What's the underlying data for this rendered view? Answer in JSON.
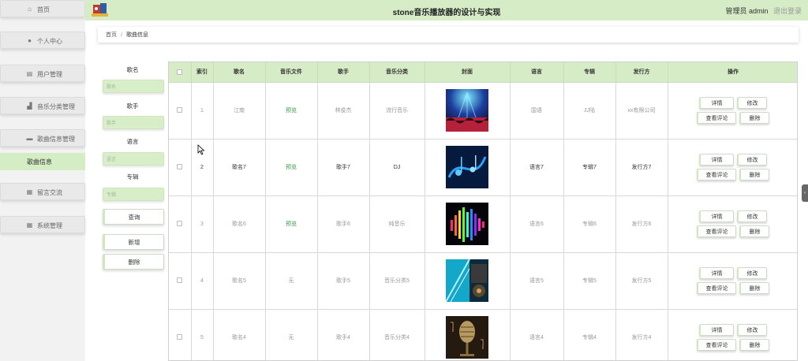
{
  "header": {
    "title": "stone音乐播放器的设计与实现",
    "admin_text": "管理员 admin",
    "logout": "退出登录"
  },
  "sidebar": {
    "items": [
      {
        "label": "首页",
        "icon": "home-icon"
      },
      {
        "label": "个人中心",
        "icon": "user-icon"
      },
      {
        "label": "用户管理",
        "icon": "clipboard-icon"
      },
      {
        "label": "音乐分类管理",
        "icon": "hammer-icon"
      },
      {
        "label": "歌曲信息管理",
        "icon": "card-icon"
      },
      {
        "label": "留言交流",
        "icon": "grid-icon"
      },
      {
        "label": "系统管理",
        "icon": "grid-icon"
      }
    ],
    "active_sub": "歌曲信息"
  },
  "breadcrumb": {
    "home": "首页",
    "separator": "/",
    "current": "歌曲信息"
  },
  "search": {
    "song_label": "歌名",
    "song_placeholder": "歌名",
    "singer_label": "歌手",
    "singer_placeholder": "歌手",
    "language_label": "语言",
    "language_placeholder": "语言",
    "album_label": "专辑",
    "album_placeholder": "专辑",
    "query_button": "查询",
    "add_button": "新增",
    "delete_button": "删除"
  },
  "table": {
    "headers": [
      "",
      "索引",
      "歌名",
      "音乐文件",
      "歌手",
      "音乐分类",
      "封面",
      "语言",
      "专辑",
      "发行方",
      "操作"
    ],
    "actions": {
      "detail": "详情",
      "edit": "修改",
      "comments": "查看评论",
      "delete": "删除"
    },
    "rows": [
      {
        "index": "1",
        "name": "江南",
        "file": "预览",
        "singer": "林俊杰",
        "category": "流行音乐",
        "language": "国语",
        "album": "JJ陆",
        "publisher": "xx有限公司",
        "cover": "concert-crowd",
        "dark": false,
        "file_link": true
      },
      {
        "index": "2",
        "name": "歌名7",
        "file": "预览",
        "singer": "歌手7",
        "category": "DJ",
        "language": "语言7",
        "album": "专辑7",
        "publisher": "发行方7",
        "cover": "blue-music-notes",
        "dark": true,
        "file_link": true
      },
      {
        "index": "3",
        "name": "歌名6",
        "file": "预览",
        "singer": "歌手6",
        "category": "纯音乐",
        "language": "语言6",
        "album": "专辑6",
        "publisher": "发行方6",
        "cover": "rainbow-equalizer",
        "dark": false,
        "file_link": true
      },
      {
        "index": "4",
        "name": "歌名5",
        "file": "无",
        "singer": "歌手5",
        "category": "音乐分类5",
        "language": "语言5",
        "album": "专辑5",
        "publisher": "发行方5",
        "cover": "cyan-music-collage",
        "dark": false,
        "file_link": false
      },
      {
        "index": "5",
        "name": "歌名4",
        "file": "无",
        "singer": "歌手4",
        "category": "音乐分类4",
        "language": "语言4",
        "album": "专辑4",
        "publisher": "发行方4",
        "cover": "vintage-microphone",
        "dark": false,
        "file_link": false
      }
    ]
  },
  "colors": {
    "accent_green": "#d6ecc6",
    "link_green": "#3a9a48"
  }
}
